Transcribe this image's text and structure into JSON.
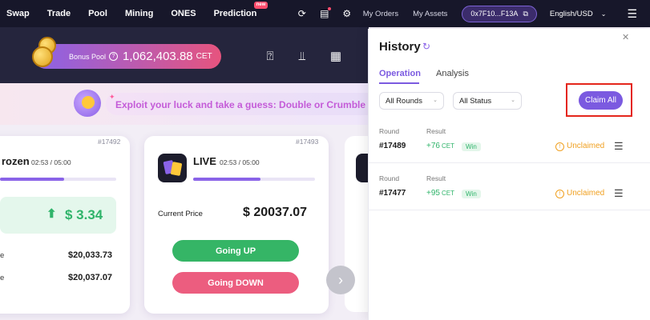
{
  "nav": {
    "links": [
      "Swap",
      "Trade",
      "Pool",
      "Mining",
      "ONES",
      "Prediction"
    ],
    "new_badge": "new",
    "my_orders": "My Orders",
    "my_assets": "My Assets",
    "wallet_address": "0x7F10...F13A",
    "language": "English/USD"
  },
  "bonus_pool": {
    "label": "Bonus Pool",
    "amount": "1,062,403.88",
    "currency": "CET"
  },
  "guess_banner": {
    "text": "Exploit your luck and take a guess: Double or Crumble"
  },
  "cards": [
    {
      "round": "#17492",
      "status": "rozen",
      "time": "02:53 / 05:00",
      "progress": 0.55,
      "change": "$ 3.34",
      "rows": [
        {
          "label": "e",
          "value": "$20,033.73"
        },
        {
          "label": "e",
          "value": "$20,037.07"
        }
      ]
    },
    {
      "round": "#17493",
      "status": "LIVE",
      "time": "02:53 / 05:00",
      "progress": 0.55,
      "current_price_label": "Current Price",
      "current_price": "$ 20037.07",
      "up_label": "Going UP",
      "down_label": "Going DOWN"
    }
  ],
  "history": {
    "title": "History",
    "tabs": [
      "Operation",
      "Analysis"
    ],
    "active_tab": "Operation",
    "filter_round": "All Rounds",
    "filter_status": "All Status",
    "claim_all": "Claim All",
    "col_round": "Round",
    "col_result": "Result",
    "entries": [
      {
        "round": "#17489",
        "result": "+76",
        "currency": "CET",
        "badge": "Win",
        "status": "Unclaimed"
      },
      {
        "round": "#17477",
        "result": "+95",
        "currency": "CET",
        "badge": "Win",
        "status": "Unclaimed"
      }
    ]
  },
  "colors": {
    "accent": "#7b5ae0",
    "up": "#35b566",
    "down": "#ec5d7f",
    "highlight": "#e4261c",
    "warning": "#f0a020"
  }
}
